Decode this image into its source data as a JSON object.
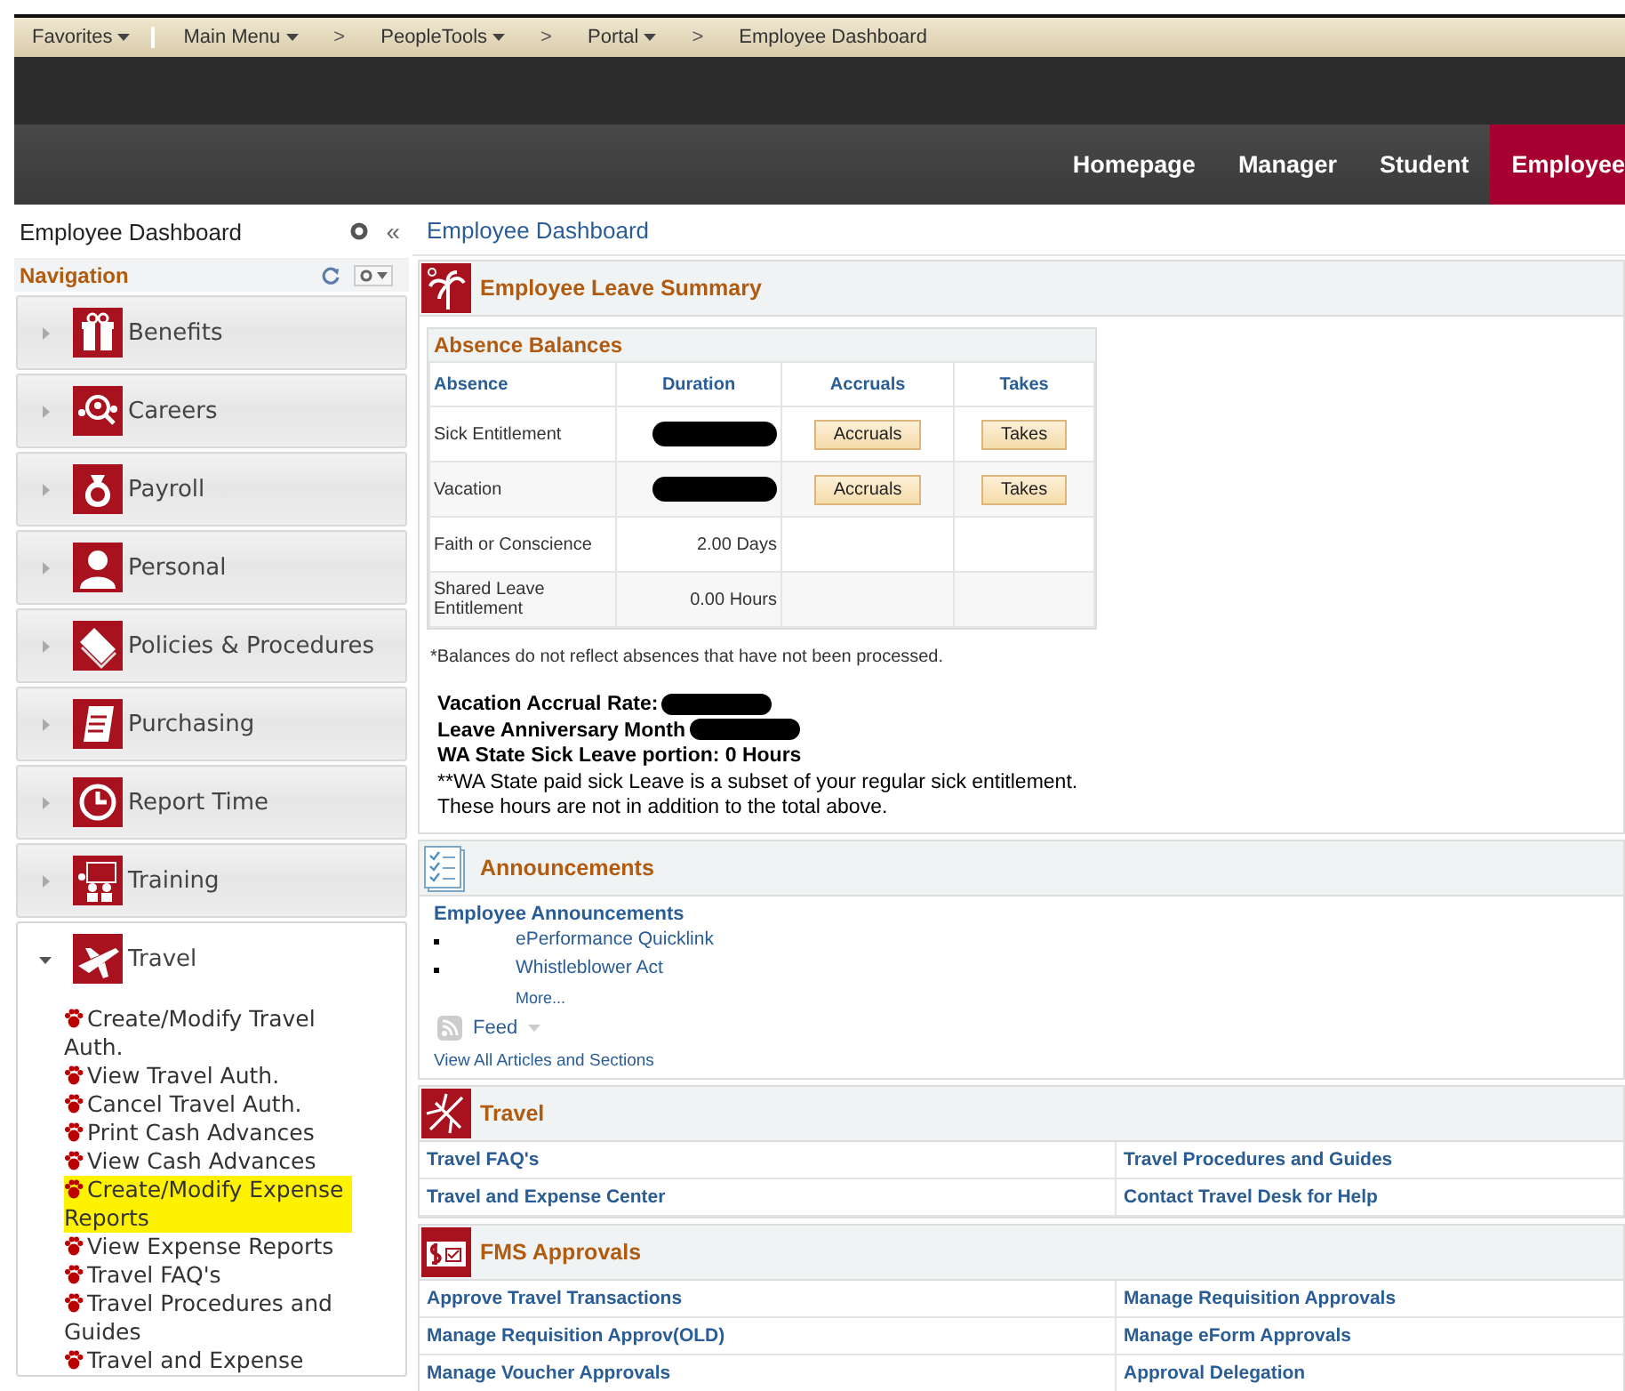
{
  "breadcrumbs": [
    {
      "label": "Favorites",
      "dropdown": true
    },
    {
      "label": "Main Menu",
      "dropdown": true
    },
    {
      "label": "PeopleTools",
      "dropdown": true,
      "separator": ">"
    },
    {
      "label": "Portal",
      "dropdown": true,
      "separator": ">"
    },
    {
      "label": "Employee Dashboard",
      "dropdown": false,
      "separator": ">"
    }
  ],
  "nav_tabs": [
    {
      "label": "Homepage",
      "selected": false
    },
    {
      "label": "Manager",
      "selected": false
    },
    {
      "label": "Student",
      "selected": false
    },
    {
      "label": "Employee",
      "selected": true
    }
  ],
  "sidebar": {
    "title": "Employee Dashboard",
    "collapse": "«",
    "nav_label": "Navigation",
    "items": [
      {
        "label": "Benefits",
        "expanded": false
      },
      {
        "label": "Careers",
        "expanded": false
      },
      {
        "label": "Payroll",
        "expanded": false
      },
      {
        "label": "Personal",
        "expanded": false
      },
      {
        "label": "Policies & Procedures",
        "expanded": false
      },
      {
        "label": "Purchasing",
        "expanded": false
      },
      {
        "label": "Report Time",
        "expanded": false
      },
      {
        "label": "Training",
        "expanded": false
      },
      {
        "label": "Travel",
        "expanded": true,
        "children": [
          {
            "label": "Create/Modify Travel Auth.",
            "highlighted": false
          },
          {
            "label": "View Travel Auth.",
            "highlighted": false
          },
          {
            "label": "Cancel Travel Auth.",
            "highlighted": false
          },
          {
            "label": "Print Cash Advances",
            "highlighted": false
          },
          {
            "label": "View Cash Advances",
            "highlighted": false
          },
          {
            "label": "Create/Modify Expense Reports",
            "highlighted": true
          },
          {
            "label": "View Expense Reports",
            "highlighted": false
          },
          {
            "label": "Travel FAQ's",
            "highlighted": false
          },
          {
            "label": "Travel Procedures and Guides",
            "highlighted": false
          },
          {
            "label": "Travel and Expense",
            "highlighted": false
          }
        ]
      }
    ]
  },
  "main": {
    "title": "Employee Dashboard",
    "leave_summary": {
      "title": "Employee Leave Summary",
      "table_title": "Absence Balances",
      "columns": [
        "Absence",
        "Duration",
        "Accruals",
        "Takes"
      ],
      "rows": [
        {
          "absence": "Sick Entitlement",
          "kind": "redacted",
          "accruals": "Accruals",
          "takes": "Takes"
        },
        {
          "absence": "Vacation",
          "kind": "redacted",
          "accruals": "Accruals",
          "takes": "Takes"
        },
        {
          "absence": "Faith or Conscience",
          "kind": "text",
          "duration": "2.00 Days"
        },
        {
          "absence": "Shared Leave Entitlement",
          "kind": "text",
          "duration": "0.00 Hours"
        }
      ],
      "footnote": "*Balances do not reflect absences that have not been processed.",
      "lines": [
        {
          "text": "Vacation Accrual Rate:",
          "bold": true,
          "redacted": true
        },
        {
          "text": "Leave Anniversary Month",
          "bold": true,
          "redacted": true
        },
        {
          "text": "WA State Sick Leave portion: 0 Hours",
          "bold": true,
          "redacted": false
        },
        {
          "text": "**WA State paid sick Leave is a subset of your regular sick entitlement.",
          "bold": false,
          "redacted": false
        },
        {
          "text": "These hours are not in addition to the total above.",
          "bold": false,
          "redacted": false
        }
      ]
    },
    "announcements": {
      "title": "Announcements",
      "heading": "Employee Announcements",
      "items": [
        "ePerformance Quicklink",
        "Whistleblower Act"
      ],
      "more": "More...",
      "feed": "Feed",
      "view_all": "View All Articles and Sections"
    },
    "travel": {
      "title": "Travel",
      "links": [
        "Travel FAQ's",
        "Travel Procedures and Guides",
        "Travel and Expense Center",
        "Contact Travel Desk for Help"
      ]
    },
    "fms_approvals": {
      "title": "FMS Approvals",
      "links": [
        "Approve Travel Transactions",
        "Manage Requisition Approvals",
        "Manage Requisition Approv(OLD)",
        "Manage eForm Approvals",
        "Manage Voucher Approvals",
        "Approval Delegation"
      ]
    }
  }
}
